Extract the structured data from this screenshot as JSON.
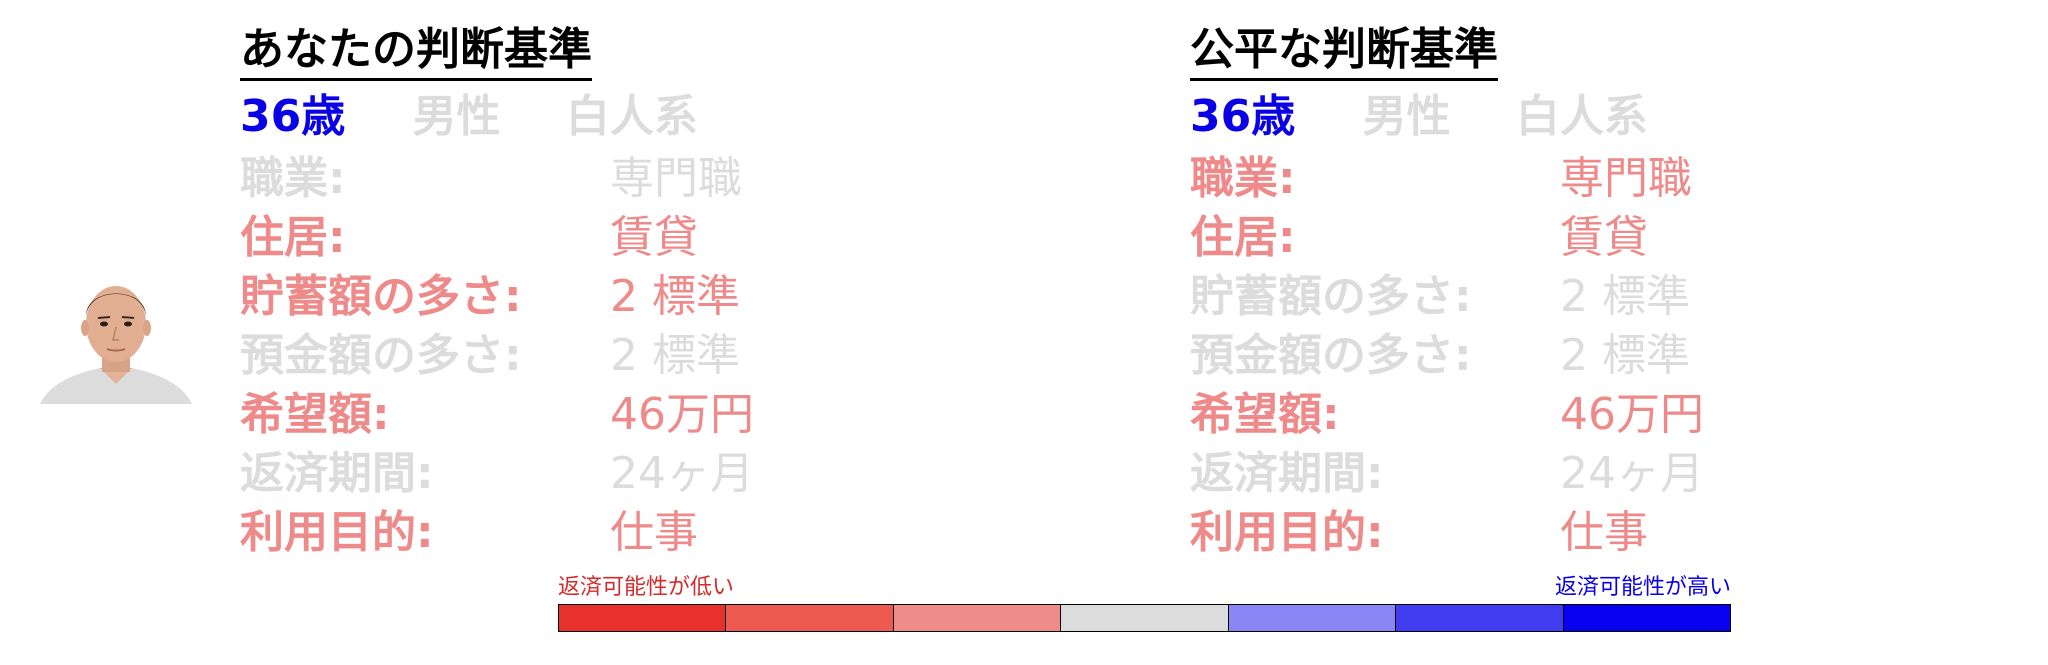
{
  "subject": {
    "photo_icon": "person-portrait-icon",
    "age": "36歳",
    "gender": "男性",
    "ethnicity": "白人系"
  },
  "panels": [
    {
      "title": "あなたの判断基準",
      "demographics": {
        "age_highlight": "blue",
        "gender_highlight": "muted",
        "ethnicity_highlight": "muted"
      },
      "attributes": [
        {
          "label": "職業:",
          "value": "専門職",
          "highlight": "muted"
        },
        {
          "label": "住居:",
          "value": "賃貸",
          "highlight": "neg"
        },
        {
          "label": "貯蓄額の多さ:",
          "value": "2 標準",
          "highlight": "neg"
        },
        {
          "label": "預金額の多さ:",
          "value": "2 標準",
          "highlight": "muted"
        },
        {
          "label": "希望額:",
          "value": "46万円",
          "highlight": "neg"
        },
        {
          "label": "返済期間:",
          "value": "24ヶ月",
          "highlight": "muted"
        },
        {
          "label": "利用目的:",
          "value": "仕事",
          "highlight": "neg"
        }
      ]
    },
    {
      "title": "公平な判断基準",
      "demographics": {
        "age_highlight": "blue",
        "gender_highlight": "muted",
        "ethnicity_highlight": "muted"
      },
      "attributes": [
        {
          "label": "職業:",
          "value": "専門職",
          "highlight": "neg"
        },
        {
          "label": "住居:",
          "value": "賃貸",
          "highlight": "neg"
        },
        {
          "label": "貯蓄額の多さ:",
          "value": "2 標準",
          "highlight": "muted"
        },
        {
          "label": "預金額の多さ:",
          "value": "2 標準",
          "highlight": "muted"
        },
        {
          "label": "希望額:",
          "value": "46万円",
          "highlight": "neg"
        },
        {
          "label": "返済期間:",
          "value": "24ヶ月",
          "highlight": "muted"
        },
        {
          "label": "利用目的:",
          "value": "仕事",
          "highlight": "neg"
        }
      ]
    }
  ],
  "scale": {
    "low_label": "返済可能性が低い",
    "high_label": "返済可能性が高い",
    "colors": [
      "#e8312a",
      "#ec5a52",
      "#ed8c88",
      "#dcdcdc",
      "#8a86f5",
      "#413cf0",
      "#0a00f0"
    ]
  },
  "colors": {
    "muted": "#dcdcdc",
    "neg": "#ef8a8a",
    "blue": "#0a00e6",
    "title": "#000000"
  }
}
